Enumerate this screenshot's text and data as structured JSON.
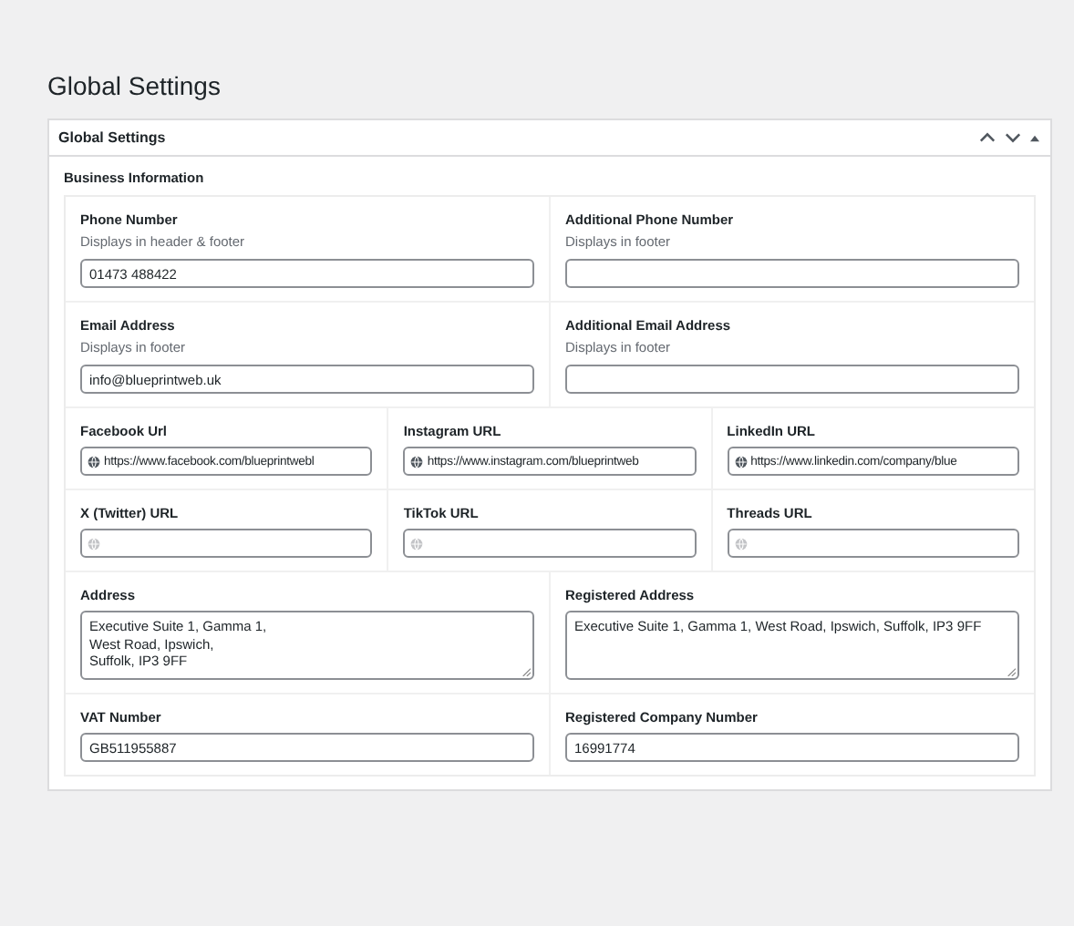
{
  "page_title": "Global Settings",
  "panel": {
    "title": "Global Settings",
    "section": "Business Information",
    "rows": [
      {
        "fields": [
          {
            "kind": "text",
            "label": "Phone Number",
            "hint": "Displays in header & footer",
            "value": "01473 488422"
          },
          {
            "kind": "text",
            "label": "Additional Phone Number",
            "hint": "Displays in footer"
          }
        ]
      },
      {
        "fields": [
          {
            "kind": "text",
            "label": "Email Address",
            "hint": "Displays in footer",
            "value": "info@blueprintweb.uk"
          },
          {
            "kind": "text",
            "label": "Additional Email Address",
            "hint": "Displays in footer"
          }
        ]
      },
      {
        "fields": [
          {
            "kind": "url",
            "label": "Facebook Url",
            "value": "https://www.facebook.com/blueprintwebl"
          },
          {
            "kind": "url",
            "label": "Instagram URL",
            "value": "https://www.instagram.com/blueprintweb"
          },
          {
            "kind": "url",
            "label": "LinkedIn URL",
            "value": "https://www.linkedin.com/company/blue"
          }
        ]
      },
      {
        "fields": [
          {
            "kind": "url",
            "label": "X (Twitter) URL"
          },
          {
            "kind": "url",
            "label": "TikTok URL"
          },
          {
            "kind": "url",
            "label": "Threads URL"
          }
        ]
      },
      {
        "fields": [
          {
            "kind": "textarea",
            "label": "Address",
            "lines": [
              "Executive Suite 1, Gamma 1,",
              "West Road, Ipswich,",
              "Suffolk, IP3 9FF"
            ]
          },
          {
            "kind": "textarea",
            "label": "Registered Address",
            "lines": [
              "Executive Suite 1, Gamma 1, West Road, Ipswich, Suffolk, IP3 9FF"
            ]
          }
        ]
      },
      {
        "fields": [
          {
            "kind": "text",
            "label": "VAT Number",
            "value": "GB511955887"
          },
          {
            "kind": "text",
            "label": "Registered Company Number",
            "value": "16991774"
          }
        ]
      }
    ]
  }
}
